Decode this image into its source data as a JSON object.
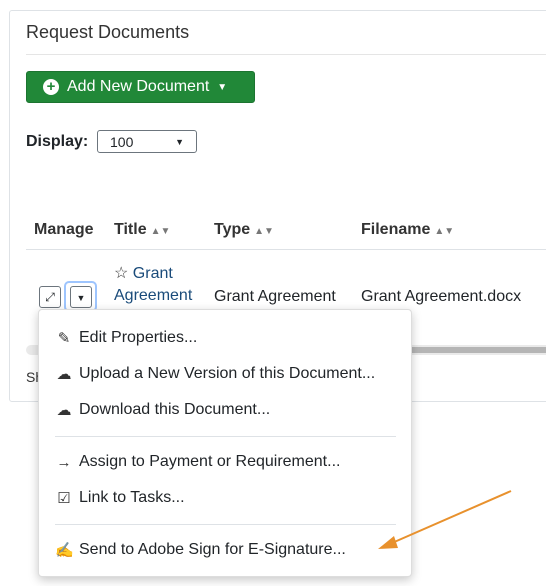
{
  "panel": {
    "title": "Request Documents"
  },
  "add_button": {
    "label": "Add New Document"
  },
  "display": {
    "label": "Display:",
    "value": "100"
  },
  "table": {
    "headers": {
      "manage": "Manage",
      "title": "Title",
      "type": "Type",
      "filename": "Filename"
    },
    "row": {
      "title_line1": "Grant",
      "title_line2": "Agreement",
      "type": "Grant Agreement",
      "filename": "Grant Agreement.docx"
    }
  },
  "footer": {
    "showing_partial": "Sh"
  },
  "menu": {
    "items": [
      {
        "label": "Edit Properties..."
      },
      {
        "label": "Upload a New Version of this Document..."
      },
      {
        "label": "Download this Document..."
      },
      {
        "label": "Assign to Payment or Requirement..."
      },
      {
        "label": "Link to Tasks..."
      },
      {
        "label": "Send to Adobe Sign for E-Signature..."
      }
    ]
  },
  "colors": {
    "primary_button": "#218838",
    "link": "#1a4b7a",
    "annotation_arrow": "#e8912d"
  }
}
